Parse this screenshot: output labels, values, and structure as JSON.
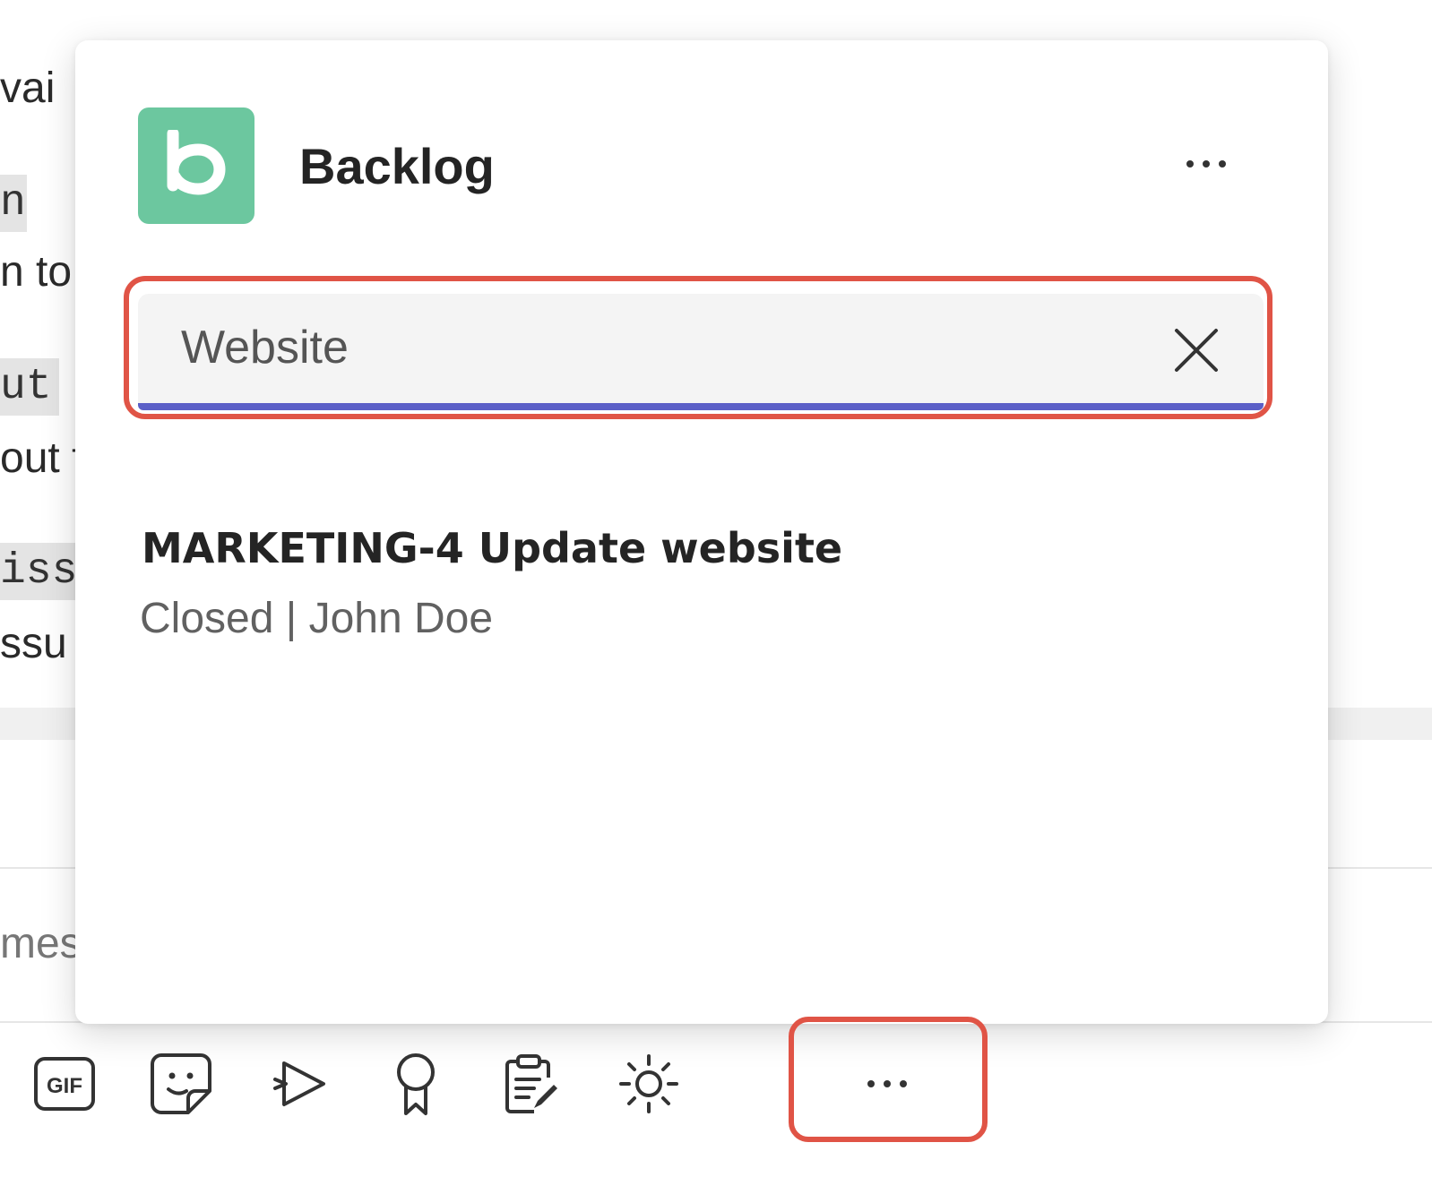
{
  "background": {
    "fragments": [
      "vai",
      "n",
      "n to",
      "ut",
      "out f",
      "iss",
      "ssu",
      "mes"
    ]
  },
  "popup": {
    "app_name": "Backlog",
    "app_icon_letter": "b",
    "app_icon_color": "#6cc79f",
    "search": {
      "value": "Website",
      "placeholder": ""
    },
    "results": [
      {
        "title": "MARKETING-4 Update website",
        "status": "Closed",
        "separator": "|",
        "assignee": "John Doe"
      }
    ]
  },
  "toolbar": {
    "items": [
      {
        "name": "gif",
        "label": "GIF",
        "icon": "gif-icon"
      },
      {
        "name": "sticker",
        "icon": "sticker-icon"
      },
      {
        "name": "stream",
        "icon": "stream-icon"
      },
      {
        "name": "praise",
        "icon": "praise-icon"
      },
      {
        "name": "approvals",
        "icon": "clipboard-icon"
      },
      {
        "name": "brightness",
        "icon": "sun-icon"
      },
      {
        "name": "more",
        "icon": "more-icon"
      }
    ]
  },
  "colors": {
    "accent": "#5b5fc7",
    "highlight": "#e05446"
  }
}
